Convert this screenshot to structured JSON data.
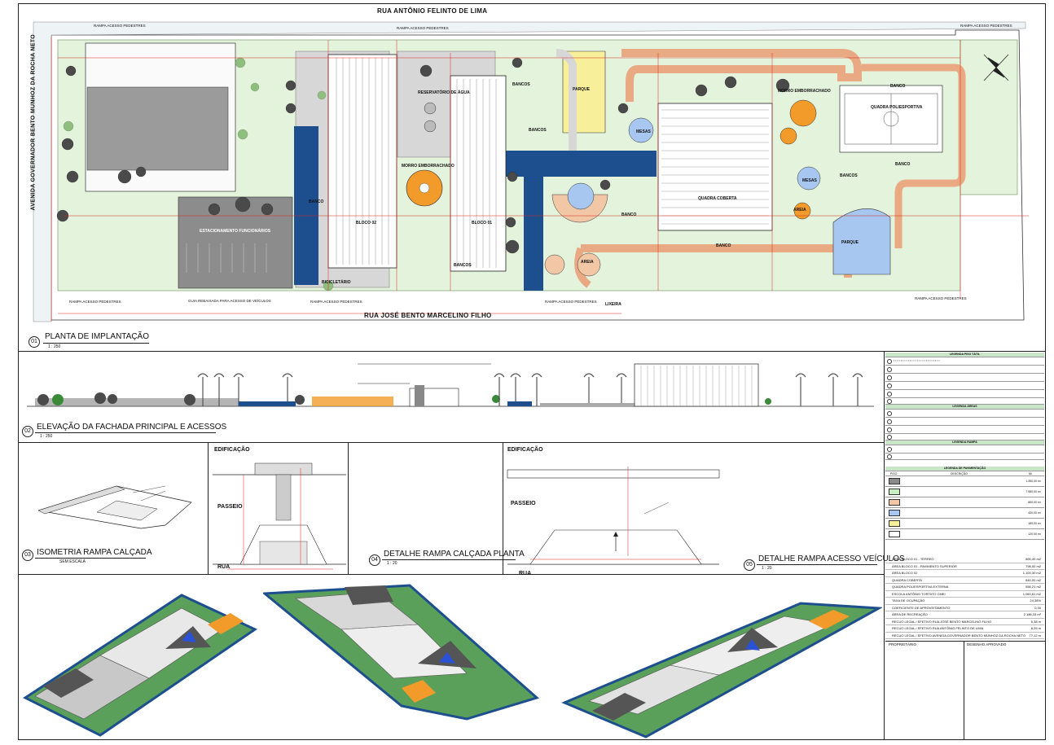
{
  "streets": {
    "top": "RUA ANTÔNIO FELINTO DE LIMA",
    "bottom": "RUA JOSÉ BENTO MARCELINO FILHO",
    "left": "AVENIDA GOVERNADOR BENTO MUNHOZ DA ROCHA NETO"
  },
  "site_labels": {
    "rampa_pedestres": "RAMPA ACESSO PEDESTRES",
    "guia_rebaixada": "GUIA REBAIXADA PARA ACESSO DE VEÍCULOS",
    "estacionamento": "ESTACIONAMENTO FUNCIONÁRIOS",
    "bloco02": "BLOCO 02",
    "bloco01": "BLOCO 01",
    "morro": "MORRO EMBORRACHADO",
    "reservatorio": "RESERVATÓRIO DE ÁGUA",
    "parque": "PARQUE",
    "bancos": "BANCOS",
    "banco": "BANCO",
    "mesas": "MESAS",
    "quadra_coberta": "QUADRA COBERTA",
    "quadra_poli": "QUADRA POLIESPORTIVA",
    "areia": "AREIA",
    "bicicletario": "BICICLETÁRIO",
    "lixeira": "LIXEIRA"
  },
  "views": {
    "v01": {
      "num": "01",
      "title": "PLANTA  DE IMPLANTAÇÃO",
      "scale": "1 : 250"
    },
    "v02": {
      "num": "02",
      "title": "ELEVAÇÃO DA FACHADA PRINCIPAL E ACESSOS",
      "scale": "1 : 250"
    },
    "v03": {
      "num": "03",
      "title": "ISOMETRIA RAMPA CALÇADA",
      "scale": "SEM ESCALA"
    },
    "v04": {
      "num": "04",
      "title": "DETALHE RAMPA CALÇADA PLANTA",
      "scale": "1 : 20"
    },
    "v05": {
      "num": "05",
      "title": "DETALHE RAMPA ACESSO VEÍCULOS",
      "scale": "1 : 20"
    }
  },
  "details": {
    "edificacao": "EDIFICAÇÃO",
    "passeio": "PASSEIO",
    "rua": "RUA"
  },
  "legend": {
    "rows": [
      "LEGENDA PISO TÁTIL",
      "LEGENDA ÁREAS",
      "LEGENDA RAMPA",
      "LEGENDA DE PAVIMENTAÇÃO"
    ],
    "pav_head": [
      "PISO",
      "DESCRIÇÃO",
      "M²"
    ]
  },
  "swatches": [
    {
      "color": "#8a8a8a",
      "value": "1.350,00 m²"
    },
    {
      "color": "#c9ecc2",
      "value": "7.980,00 m²"
    },
    {
      "color": "#f2c7a6",
      "value": "860,00 m²"
    },
    {
      "color": "#a7c7f0",
      "value": "420,00 m²"
    },
    {
      "color": "#f7f09a",
      "value": "180,00 m²"
    },
    {
      "color": "#ffffff",
      "value": "120,00 m²"
    }
  ],
  "areas": [
    {
      "k": "ÁREA BLOCO 01 - TÉRREO",
      "v": "800,40 m2"
    },
    {
      "k": "ÁREA BLOCO 01 - PAVIMENTO SUPERIOR",
      "v": "798,00 m2"
    },
    {
      "k": "ÁREA BLOCO 02",
      "v": "1.100,30 m2"
    },
    {
      "k": "QUADRA COBERTA",
      "v": "840,00 m2"
    },
    {
      "k": "QUADRA POLIESPORTIVA EXTERNA",
      "v": "556,21 m2"
    },
    {
      "k": "ESCOLA ANTÔNIO TORTATO CMEI",
      "v": "1.060,61 m2"
    },
    {
      "k": "TAXA DE OCUPAÇÃO",
      "v": "24,38%"
    },
    {
      "k": "COEFICIENTE DE APROVEITAMENTO",
      "v": "0,30"
    },
    {
      "k": "ÁREA DE RECREAÇÃO",
      "v": "2.186,33 m²"
    },
    {
      "k": "RECUO LEGAL / EFETIVO RUA JOSÉ BENTO MARCELINO FILHO",
      "v": "5,38 m"
    },
    {
      "k": "RECUO LEGAL / EFETIVO RUA ANTÔNIO FELINTO DE LIMA",
      "v": "6,25 m"
    },
    {
      "k": "RECUO LEGAL / EFETIVO AVENIDA GOVERNADOR BENTO MUNHOZ DA ROCHA NETO",
      "v": "77,12 m"
    }
  ],
  "stamp": {
    "left": "PROPRIETÁRIO",
    "right": "DESENHO APROVADO"
  },
  "colors": {
    "grass": "#e4f3dc",
    "walk": "#f2c7a6",
    "building": "#ffffff",
    "blue": "#1d4f8f",
    "orange": "#f39b2a",
    "yellow": "#f7ef9a",
    "court_blue": "#a7c7f0",
    "parking": "#8c8c8c",
    "dim_red": "#d9261c"
  }
}
